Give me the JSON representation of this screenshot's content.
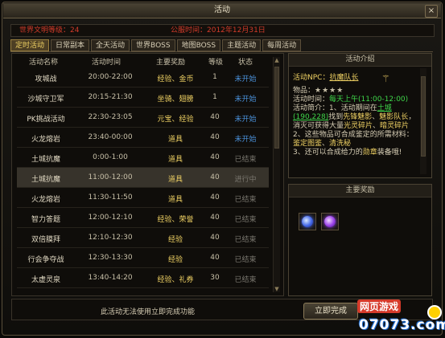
{
  "window": {
    "title": "活动",
    "close_label": "×"
  },
  "infobar": {
    "world_level": "世界文明等级：24",
    "server_time": "公服时间：2012年12月31日"
  },
  "tabs": [
    {
      "label": "定时活动",
      "active": true
    },
    {
      "label": "日常副本",
      "active": false
    },
    {
      "label": "全天活动",
      "active": false
    },
    {
      "label": "世界BOSS",
      "active": false
    },
    {
      "label": "地图BOSS",
      "active": false
    },
    {
      "label": "主题活动",
      "active": false
    },
    {
      "label": "每周活动",
      "active": false
    }
  ],
  "table": {
    "headers": {
      "name": "活动名称",
      "time": "活动时间",
      "reward": "主要奖励",
      "level": "等级",
      "status": "状态"
    },
    "rows": [
      {
        "name": "攻城战",
        "time": "20:00-22:00",
        "reward": "经验、金币",
        "level": "1",
        "status": "未开始",
        "open": true
      },
      {
        "name": "沙城守卫军",
        "time": "20:15-21:30",
        "reward": "坐骑、翅膀",
        "level": "1",
        "status": "未开始",
        "open": true
      },
      {
        "name": "PK挑战活动",
        "time": "22:30-23:05",
        "reward": "元宝、经验",
        "level": "40",
        "status": "未开始",
        "open": true
      },
      {
        "name": "火龙熔岩",
        "time": "23:40-00:00",
        "reward": "道具",
        "level": "40",
        "status": "未开始",
        "open": true
      },
      {
        "name": "土城抗魔",
        "time": "0:00-1:00",
        "reward": "道具",
        "level": "40",
        "status": "已结束",
        "open": false
      },
      {
        "name": "土城抗魔",
        "time": "11:00-12:00",
        "reward": "道具",
        "level": "40",
        "status": "进行中",
        "open": false
      },
      {
        "name": "火龙熔岩",
        "time": "11:30-11:50",
        "reward": "道具",
        "level": "40",
        "status": "已结束",
        "open": false
      },
      {
        "name": "智力答题",
        "time": "12:00-12:10",
        "reward": "经验、荣誉",
        "level": "40",
        "status": "已结束",
        "open": false
      },
      {
        "name": "双倍膜拜",
        "time": "12:10-12:30",
        "reward": "经验",
        "level": "40",
        "status": "已结束",
        "open": false
      },
      {
        "name": "行会争夺战",
        "time": "12:30-13:30",
        "reward": "经验",
        "level": "40",
        "status": "已结束",
        "open": false
      },
      {
        "name": "太虚灵泉",
        "time": "13:40-14:20",
        "reward": "经验、礼券",
        "level": "30",
        "status": "已结束",
        "open": false
      }
    ]
  },
  "intro": {
    "title": "活动介绍",
    "npc_label": "活动NPC：",
    "npc_name": "抗魔队长",
    "item_label": "物品：",
    "stars": "★★★★",
    "time_label": "活动时间：",
    "time_value": "每天上午(11:00-12:00)",
    "desc1_a": "活动简介：1、活动期间在",
    "desc1_link": "土城(190,228)",
    "desc1_b": "找到",
    "desc1_c": "先锋魅影",
    "desc1_d": "、",
    "desc1_e": "魅影队长",
    "desc1_f": "，消灭可获得大量",
    "desc1_g": "光灵碎片",
    "desc1_h": "、",
    "desc1_i": "暗灵碎片",
    "desc2_a": "2、这些物品可合成鉴定的所需材料：",
    "desc2_b": "鉴定图鉴",
    "desc2_c": "、",
    "desc2_d": "清洗秘",
    "desc3_a": "3、还可以合成给力的",
    "desc3_b": "勋章",
    "desc3_c": "装备哦!"
  },
  "rewards": {
    "title": "主要奖励",
    "items": [
      {
        "icon": "blue-orb-icon"
      },
      {
        "icon": "purple-orb-icon"
      }
    ]
  },
  "bottom": {
    "notice": "此活动无法使用立即完成功能",
    "finish_label": "立即完成"
  },
  "watermark": {
    "top": "网页游戏",
    "bottom": "07073.com"
  }
}
